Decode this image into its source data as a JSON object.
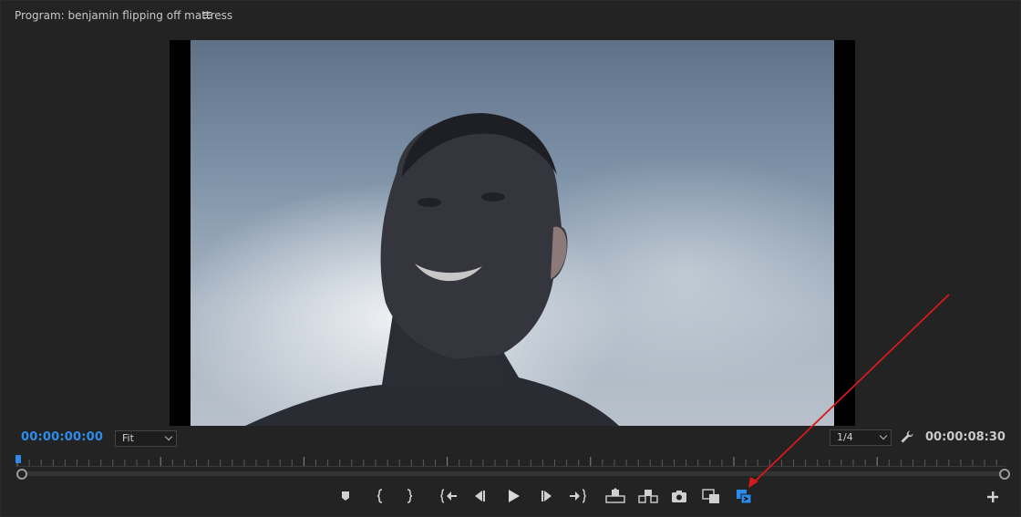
{
  "panel": {
    "title": "Program: benjamin flipping off mattress"
  },
  "viewer": {
    "current_timecode": "00:00:00:00",
    "zoom_select": "Fit",
    "resolution_select": "1/4",
    "duration_timecode": "00:00:08:30"
  },
  "icons": {
    "menu": "hamburger-menu-icon",
    "settings": "wrench-icon",
    "add": "plus-icon"
  },
  "transport_buttons": [
    "add-marker-icon",
    "mark-in-icon",
    "mark-out-icon",
    "go-to-in-icon",
    "step-back-icon",
    "play-icon",
    "step-forward-icon",
    "go-to-out-icon",
    "lift-icon",
    "extract-icon",
    "export-frame-icon",
    "comparison-view-icon",
    "proxy-toggle-icon"
  ],
  "colors": {
    "accent": "#2d8ceb",
    "panel_bg": "#232323",
    "annotation": "#d7191c"
  },
  "playhead_position_fraction": 0
}
